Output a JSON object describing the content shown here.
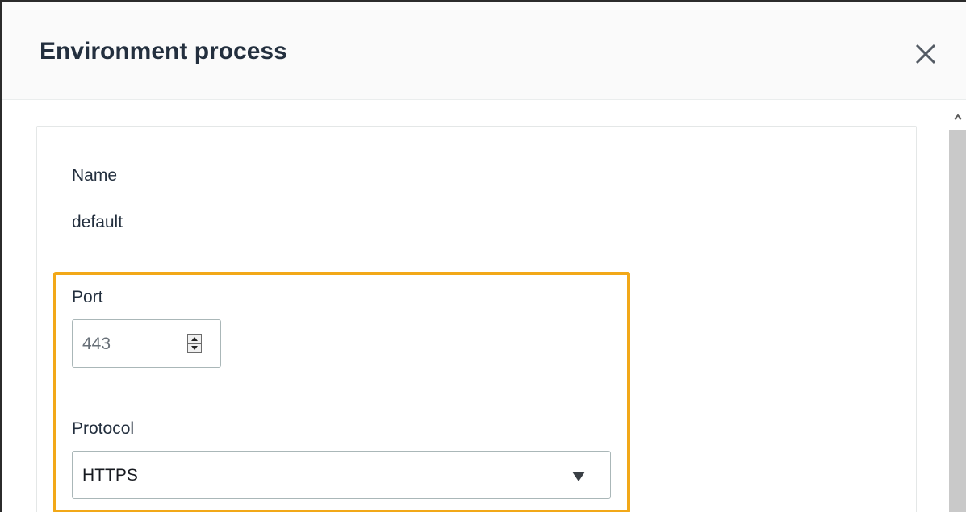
{
  "modal": {
    "title": "Environment process",
    "close_icon": "close-icon"
  },
  "form": {
    "name_label": "Name",
    "name_value": "default",
    "port_label": "Port",
    "port_value": "443",
    "protocol_label": "Protocol",
    "protocol_value": "HTTPS"
  },
  "colors": {
    "highlight": "#f2a818",
    "title": "#232f3e",
    "header_bg": "#fafafa",
    "scrollbar_thumb": "#c9c9c9"
  },
  "icons": {
    "stepper": "spinner-arrows-icon",
    "dropdown": "caret-down-icon",
    "scroll_up": "chevron-up-icon"
  }
}
